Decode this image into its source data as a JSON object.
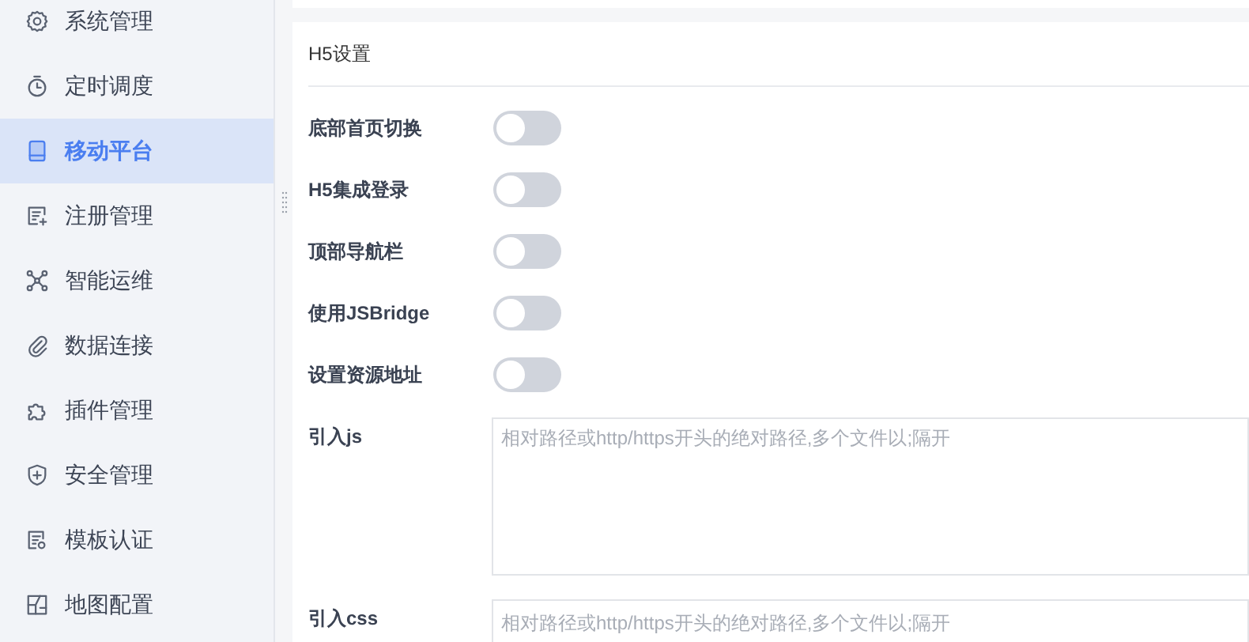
{
  "sidebar": {
    "items": [
      {
        "label": "系统管理",
        "selected": false
      },
      {
        "label": "定时调度",
        "selected": false
      },
      {
        "label": "移动平台",
        "selected": true
      },
      {
        "label": "注册管理",
        "selected": false
      },
      {
        "label": "智能运维",
        "selected": false
      },
      {
        "label": "数据连接",
        "selected": false
      },
      {
        "label": "插件管理",
        "selected": false
      },
      {
        "label": "安全管理",
        "selected": false
      },
      {
        "label": "模板认证",
        "selected": false
      },
      {
        "label": "地图配置",
        "selected": false
      }
    ]
  },
  "panel": {
    "title": "H5设置",
    "switches": [
      {
        "label": "底部首页切换",
        "on": false
      },
      {
        "label": "H5集成登录",
        "on": false
      },
      {
        "label": "顶部导航栏",
        "on": false
      },
      {
        "label": "使用JSBridge",
        "on": false
      },
      {
        "label": "设置资源地址",
        "on": false
      }
    ],
    "fields": [
      {
        "label": "引入js",
        "kind": "textarea",
        "placeholder": "相对路径或http/https开头的绝对路径,多个文件以;隔开"
      },
      {
        "label": "引入css",
        "kind": "input",
        "placeholder": "相对路径或http/https开头的绝对路径,多个文件以;隔开"
      }
    ]
  }
}
